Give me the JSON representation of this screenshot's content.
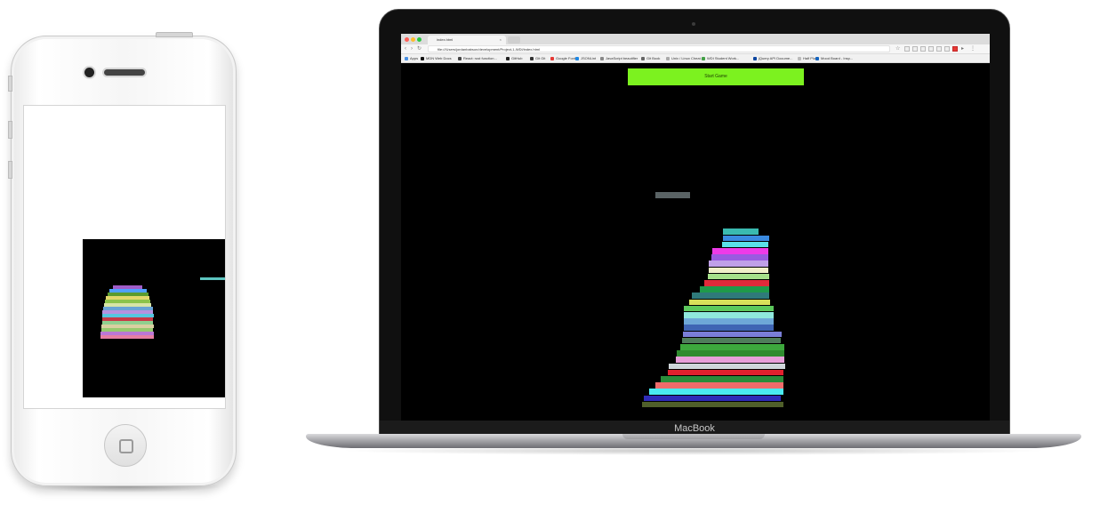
{
  "phone": {
    "colors": {
      "body": "#f5f5f5",
      "screen": "#ffffff",
      "canvas": "#000000"
    },
    "moving_block_color": "#5cc5c0",
    "stack": [
      "#e57ea3",
      "#bb77d6",
      "#96c96e",
      "#d9cfa0",
      "#8fd08f",
      "#c73a48",
      "#55c7e0",
      "#b592e0",
      "#69a3d6",
      "#d7e4a6",
      "#8bc34a",
      "#e3d76b",
      "#5b9b2f",
      "#50a0ff",
      "#a05cc8"
    ]
  },
  "browser": {
    "tab_title": "index.html",
    "tab_close": "×",
    "url": "file:///Users/jordanbabson/development/Project-1-WDI/index.html",
    "bookmarks": [
      {
        "label": "Apps",
        "color": "#4a90e2"
      },
      {
        "label": "MDN Web Docs",
        "color": "#111111"
      },
      {
        "label": "React: rust function...",
        "color": "#444444"
      },
      {
        "label": "GitHub",
        "color": "#222222"
      },
      {
        "label": "Git Git",
        "color": "#333333"
      },
      {
        "label": "Google Fonts",
        "color": "#e53935"
      },
      {
        "label": "JSONLint",
        "color": "#1e88e5"
      },
      {
        "label": "JavaScript beautifier",
        "color": "#888888"
      },
      {
        "label": "Git Book",
        "color": "#666666"
      },
      {
        "label": "Unix / Linux Cheat...",
        "color": "#aaaaaa"
      },
      {
        "label": "WDI Student Work...",
        "color": "#43a047"
      },
      {
        "label": "jQuery API Docume...",
        "color": "#0d47a1"
      },
      {
        "label": "Half Plus",
        "color": "#bbbbbb"
      },
      {
        "label": "Mood Board - Insp...",
        "color": "#1565c0"
      }
    ]
  },
  "game": {
    "start_button_label": "Start Game",
    "start_button_color": "#7cf21f",
    "moving_block_color": "#5a6365",
    "stack": [
      "#4f5f2a",
      "#2e2bb8",
      "#4aeaf0",
      "#f06b6b",
      "#2a8c3a",
      "#e0212e",
      "#cfd6da",
      "#e79fd9",
      "#2f8b2f",
      "#3da83d",
      "#4f7d5a",
      "#7a7ed8",
      "#3f65b4",
      "#6ea8d8",
      "#8fe8dc",
      "#5cc85c",
      "#d8e05a",
      "#2f7a7a",
      "#1f9a4a",
      "#e02a3a",
      "#a6e08a",
      "#f0f0c8",
      "#c0a0e8",
      "#9a5ae0",
      "#ee3ae8",
      "#5ae0e8",
      "#3a8ae0",
      "#3abab0"
    ]
  },
  "macbook": {
    "label": "MacBook"
  }
}
